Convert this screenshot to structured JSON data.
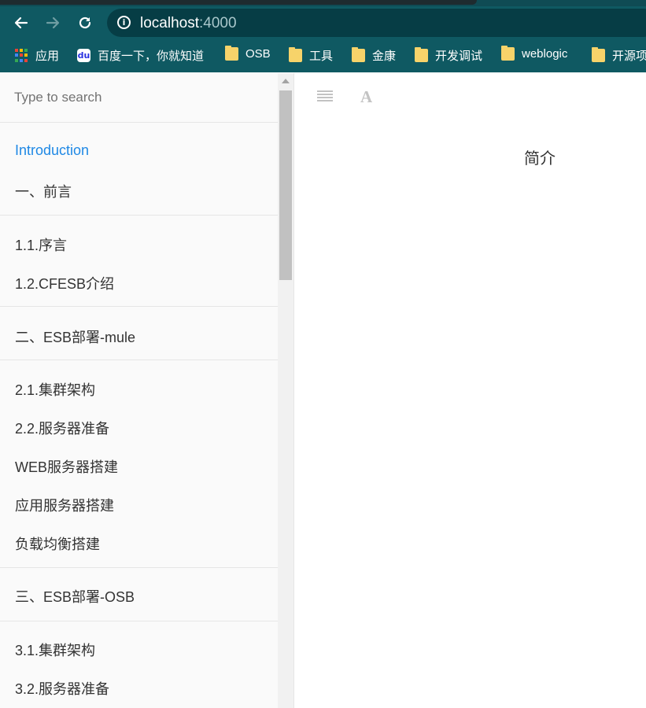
{
  "browser": {
    "url_host": "localhost",
    "url_port": ":4000",
    "bookmarks": [
      {
        "label": "应用",
        "icon": "apps-grid-icon"
      },
      {
        "label": "百度一下，你就知道",
        "icon": "baidu-icon"
      },
      {
        "label": "OSB",
        "icon": "folder-icon"
      },
      {
        "label": "工具",
        "icon": "folder-icon"
      },
      {
        "label": "金康",
        "icon": "folder-icon"
      },
      {
        "label": "开发调试",
        "icon": "folder-icon"
      },
      {
        "label": "weblogic",
        "icon": "folder-icon"
      },
      {
        "label": "开源项",
        "icon": "folder-icon"
      }
    ]
  },
  "sidebar": {
    "search_placeholder": "Type to search",
    "items": [
      {
        "label": "Introduction",
        "active": true
      },
      {
        "label": "一、前言"
      },
      {
        "label": "1.1.序言"
      },
      {
        "label": "1.2.CFESB介绍"
      },
      {
        "label": "二、ESB部署-mule"
      },
      {
        "label": "2.1.集群架构"
      },
      {
        "label": "2.2.服务器准备"
      },
      {
        "label": "WEB服务器搭建"
      },
      {
        "label": "应用服务器搭建"
      },
      {
        "label": "负载均衡搭建"
      },
      {
        "label": "三、ESB部署-OSB"
      },
      {
        "label": "3.1.集群架构"
      },
      {
        "label": "3.2.服务器准备"
      }
    ]
  },
  "content": {
    "title": "简介"
  },
  "colors": {
    "chrome": "#0f5962",
    "omnibox": "#063d45",
    "link_active": "#1e88e5",
    "folder": "#f7d36a"
  }
}
